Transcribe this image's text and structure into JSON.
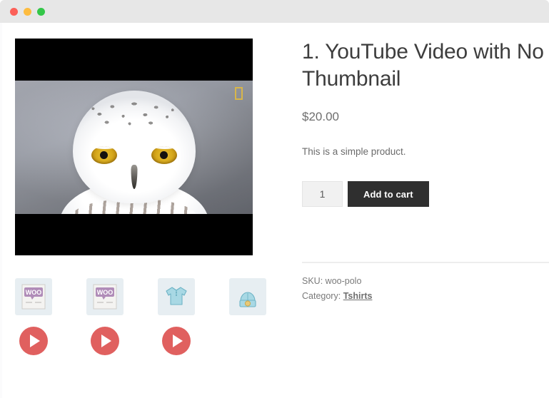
{
  "window": {
    "traffic_lights": [
      {
        "name": "close",
        "color": "#fc6058"
      },
      {
        "name": "minimize",
        "color": "#fdbc40"
      },
      {
        "name": "maximize",
        "color": "#34c749"
      }
    ]
  },
  "product": {
    "title": "1. YouTube Video with No Thumbnail",
    "price": "$20.00",
    "short_description": "This is a simple product.",
    "quantity_value": "1",
    "quantity_placeholder": "1",
    "add_to_cart_label": "Add to cart",
    "meta": {
      "sku_label": "SKU:",
      "sku_value": "woo-polo",
      "category_label": "Category:",
      "category_value": "Tshirts"
    }
  },
  "media": {
    "main": {
      "type": "video-frame",
      "subject": "snowy-owl",
      "watermark": "national-geographic-logo",
      "watermark_color": "#d8b64a",
      "letterbox_color": "#000000"
    },
    "thumbnails": [
      {
        "name": "thumbnail-woo-logo-1",
        "icon": "woo-logo-card-icon",
        "label": "WOO"
      },
      {
        "name": "thumbnail-woo-logo-2",
        "icon": "woo-logo-card-icon",
        "label": "WOO"
      },
      {
        "name": "thumbnail-polo-shirt",
        "icon": "polo-shirt-icon",
        "label": ""
      },
      {
        "name": "thumbnail-beanie",
        "icon": "beanie-icon",
        "label": ""
      }
    ],
    "play_buttons": [
      {
        "name": "play-button-1",
        "icon": "play-icon"
      },
      {
        "name": "play-button-2",
        "icon": "play-icon"
      },
      {
        "name": "play-button-3",
        "icon": "play-icon"
      }
    ],
    "play_button_color": "#e0605f"
  },
  "colors": {
    "titlebar": "#e7e7e7",
    "page_background": "#ffffff",
    "text_primary": "#3d3d3d",
    "text_secondary": "#6e6e6e",
    "button_dark": "#2f2f2f",
    "thumb_background": "#e7eef2",
    "divider": "#ededed"
  }
}
